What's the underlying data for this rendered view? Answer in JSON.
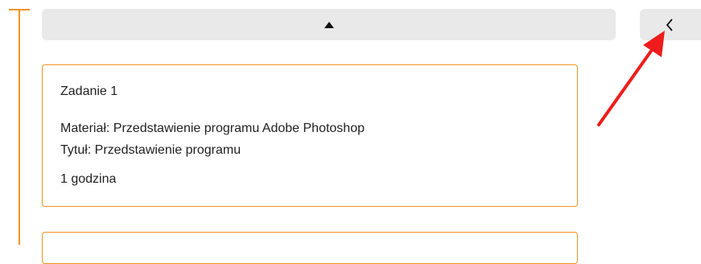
{
  "timeline": {
    "accent_color": "#f0931f"
  },
  "controls": {
    "scroll_up_icon": "triangle-up-icon",
    "collapse_icon": "chevron-left-icon"
  },
  "tasks": [
    {
      "title": "Zadanie 1",
      "material": "Materiał: Przedstawienie programu Adobe Photoshop",
      "subject": "Tytuł: Przedstawienie programu",
      "duration": "1 godzina"
    }
  ],
  "annotation": {
    "arrow_color": "#ee1c1c"
  }
}
